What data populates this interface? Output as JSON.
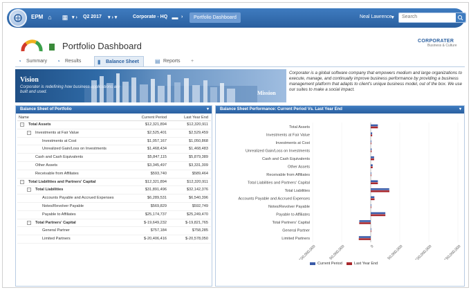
{
  "topbar": {
    "app": "EPM",
    "period": "Q2 2017",
    "location": "Corporate - HQ",
    "active_crumb": "Portfolio Dashboard",
    "user": "Neal Lawrence",
    "search_placeholder": "Search"
  },
  "header": {
    "title": "Portfolio Dashboard",
    "brand": "CORPORATER",
    "brand_sub": "Business & Culture"
  },
  "tabs": [
    {
      "label": "Summary"
    },
    {
      "label": "Results"
    },
    {
      "label": "Balance Sheet"
    },
    {
      "label": "Reports"
    }
  ],
  "banner": {
    "vision_title": "Vision",
    "vision_text": "Corporater is redefining how business applications are built and used.",
    "mission_title": "Mission"
  },
  "mission_text": "Corporater is a global software company that empowers medium and large organizations to execute, manage, and continually improve business performance by providing a business management platform that adapts to client's unique business model, out of the box. We use our suites to make a social impact.",
  "balance_sheet": {
    "title": "Balance Sheet of Portfolio",
    "columns": [
      "Name",
      "Current Period",
      "Last Year End"
    ],
    "rows": [
      {
        "name": "Total Assets",
        "cp": "$12,321,894",
        "ly": "$12,320,911",
        "level": 0,
        "bold": true,
        "exp": "-"
      },
      {
        "name": "Investments at Fair Value",
        "cp": "$2,525,401",
        "ly": "$2,529,459",
        "level": 1,
        "bold": false,
        "exp": "-"
      },
      {
        "name": "Investments at Cost",
        "cp": "$1,057,167",
        "ly": "$1,050,868",
        "level": 2,
        "bold": false,
        "exp": ""
      },
      {
        "name": "Unrealized Gain/Loss on Investments",
        "cp": "$1,468,434",
        "ly": "$1,468,483",
        "level": 2,
        "bold": false,
        "exp": ""
      },
      {
        "name": "Cash and Cash Equivalents",
        "cp": "$5,847,115",
        "ly": "$5,879,389",
        "level": 1,
        "bold": false,
        "exp": ""
      },
      {
        "name": "Other Assets",
        "cp": "$3,345,497",
        "ly": "$3,331,309",
        "level": 1,
        "bold": false,
        "exp": ""
      },
      {
        "name": "Receivable from Affiliates",
        "cp": "$593,740",
        "ly": "$589,464",
        "level": 1,
        "bold": false,
        "exp": ""
      },
      {
        "name": "Total Liabilities and Partners' Capital",
        "cp": "$12,321,894",
        "ly": "$12,320,911",
        "level": 0,
        "bold": true,
        "exp": "-"
      },
      {
        "name": "Total Liabilities",
        "cp": "$31,891,496",
        "ly": "$32,142,376",
        "level": 1,
        "bold": true,
        "exp": "-"
      },
      {
        "name": "Accounts Payable and Accrued Expenses",
        "cp": "$6,289,531",
        "ly": "$6,540,396",
        "level": 2,
        "bold": false,
        "exp": ""
      },
      {
        "name": "Notes/Revolver Payable",
        "cp": "$569,829",
        "ly": "$592,749",
        "level": 2,
        "bold": false,
        "exp": ""
      },
      {
        "name": "Payable to Affiliates",
        "cp": "$25,174,737",
        "ly": "$25,249,470",
        "level": 2,
        "bold": false,
        "exp": ""
      },
      {
        "name": "Total Partners' Capital",
        "cp": "$-19,649,232",
        "ly": "$-19,821,765",
        "level": 1,
        "bold": true,
        "exp": "-"
      },
      {
        "name": "General Partner",
        "cp": "$757,184",
        "ly": "$758,285",
        "level": 2,
        "bold": false,
        "exp": ""
      },
      {
        "name": "Limited Partners",
        "cp": "$-20,406,416",
        "ly": "$-20,578,050",
        "level": 2,
        "bold": false,
        "exp": ""
      }
    ]
  },
  "chart_panel_title": "Balance Sheet Performance: Current Period Vs. Last Year End",
  "chart_data": {
    "type": "bar",
    "orientation": "horizontal",
    "categories": [
      "Total Assets",
      "Investments at Fair Value",
      "Investments at Cost",
      "Unrealized Gain/Loss on Investments",
      "Cash and Cash Equivalents",
      "Other Assets",
      "Receivable from Affiliates",
      "Total Liabilities and Partners' Capital",
      "Total Liabilities",
      "Accounts Payable and Accrued Expenses",
      "Notes/Revolver Payable",
      "Payable to Affiliates",
      "Total Partners' Capital",
      "General Partner",
      "Limited Partners"
    ],
    "series": [
      {
        "name": "Current Period",
        "color": "#3a5ba8",
        "values": [
          12321894,
          2525401,
          1057167,
          1468434,
          5847115,
          3345497,
          593740,
          12321894,
          31891496,
          6289531,
          569829,
          25174737,
          -19649232,
          757184,
          -20406416
        ]
      },
      {
        "name": "Last Year End",
        "color": "#a8282d",
        "values": [
          12320911,
          2529459,
          1050868,
          1468483,
          5879389,
          3331309,
          589464,
          12320911,
          32142376,
          6540396,
          592749,
          25249470,
          -19821765,
          758285,
          -20578050
        ]
      }
    ],
    "xlim": [
      -100000000,
      150000000
    ],
    "xticks": [
      "-100,000,000",
      "-50,000,000",
      "0",
      "50,000,000",
      "100,000,000",
      "150,000,000"
    ],
    "legend": "bottom"
  }
}
